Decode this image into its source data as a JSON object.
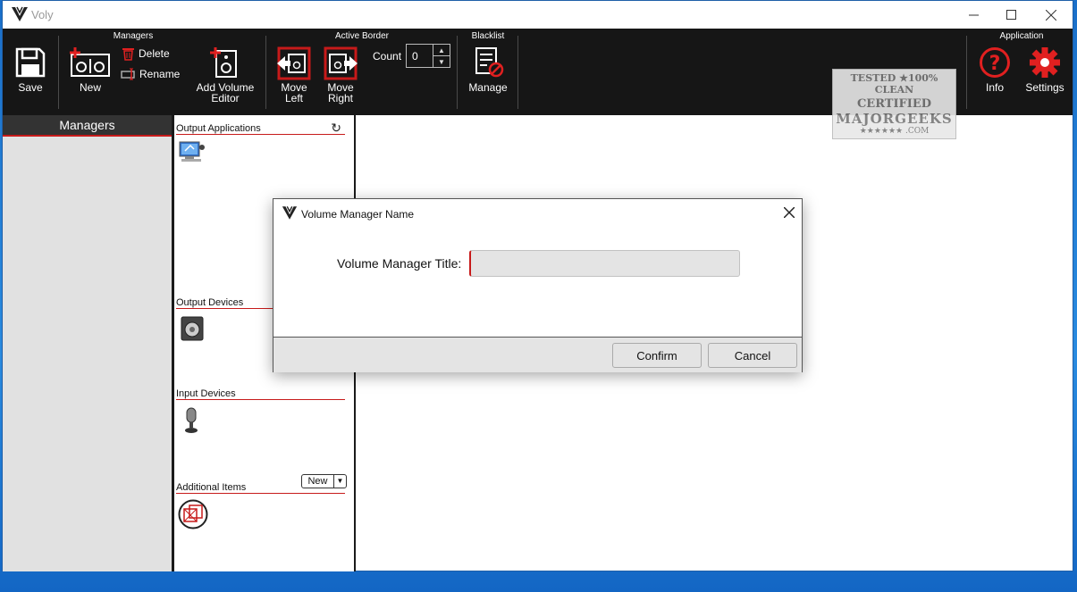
{
  "window": {
    "title": "Voly"
  },
  "ribbon": {
    "save_label": "Save",
    "managers_group": "Managers",
    "new_label": "New",
    "delete_label": "Delete",
    "rename_label": "Rename",
    "add_volume_editor_line1": "Add Volume",
    "add_volume_editor_line2": "Editor",
    "active_border_group": "Active Border",
    "move_left_line1": "Move",
    "move_left_line2": "Left",
    "move_right_line1": "Move",
    "move_right_line2": "Right",
    "count_label": "Count",
    "count_value": "0",
    "blacklist_group": "Blacklist",
    "manage_label": "Manage",
    "application_group": "Application",
    "info_label": "Info",
    "settings_label": "Settings"
  },
  "watermark": {
    "line1": "TESTED ★100% CLEAN",
    "line2": "CERTIFIED",
    "line3": "MAJORGEEKS",
    "line4": "★★★★★★ .COM"
  },
  "managers_pane": {
    "header": "Managers"
  },
  "lists_pane": {
    "output_applications": "Output Applications",
    "output_devices": "Output Devices",
    "input_devices": "Input Devices",
    "additional_items": "Additional Items",
    "new_dropdown": "New"
  },
  "dialog": {
    "title": "Volume Manager Name",
    "field_label": "Volume Manager Title:",
    "field_value": "",
    "confirm_label": "Confirm",
    "cancel_label": "Cancel"
  },
  "colors": {
    "accent": "#c71a1a",
    "ribbon_bg": "#161616",
    "pane_bg": "#e1e1e1"
  }
}
